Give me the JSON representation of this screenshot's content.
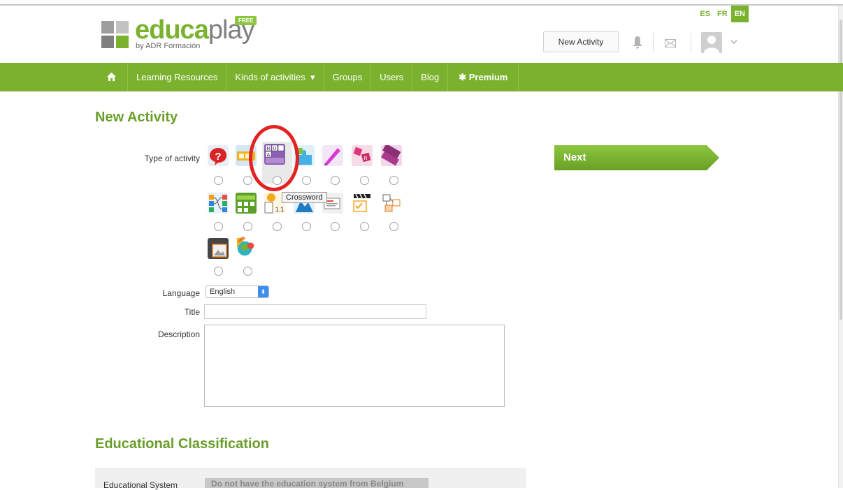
{
  "header": {
    "logo_main": "educa",
    "logo_tail": "play",
    "logo_byline": "by ADR Formación",
    "logo_badge": "FREE",
    "new_activity_label": "New Activity",
    "languages": [
      "ES",
      "FR",
      "EN"
    ],
    "active_language": "EN"
  },
  "nav": {
    "home_icon": "home-icon",
    "items": [
      "Learning Resources",
      "Kinds of activities",
      "Groups",
      "Users",
      "Blog",
      "Premium"
    ],
    "dropdown_caret": "▾",
    "premium_star": "✱"
  },
  "main": {
    "title": "New Activity",
    "type_label": "Type of activity",
    "tooltip": "Crossword",
    "language_label": "Language",
    "language_value": "English",
    "title_label": "Title",
    "title_value": "",
    "description_label": "Description",
    "description_value": "",
    "next_label": "Next"
  },
  "activity_icons": [
    [
      "quiz-icon",
      "alphabet-icon",
      "crossword-icon",
      "puzzle-icon",
      "writing-icon",
      "word-search-icon",
      "word-letters-icon"
    ],
    [
      "relate-icon",
      "word-grid-icon",
      "numbers-icon",
      "map-icon",
      "slides-icon",
      "video-quiz-icon",
      "diagram-icon"
    ],
    [
      "image-icon",
      "new-game-icon"
    ]
  ],
  "classification": {
    "title": "Educational Classification",
    "system_label": "Educational System",
    "system_value": "Do not have the education system from Belgium"
  },
  "colors": {
    "brand_green": "#7ab22e",
    "heading_green": "#6a9e2a",
    "highlight_red": "#e32222"
  }
}
